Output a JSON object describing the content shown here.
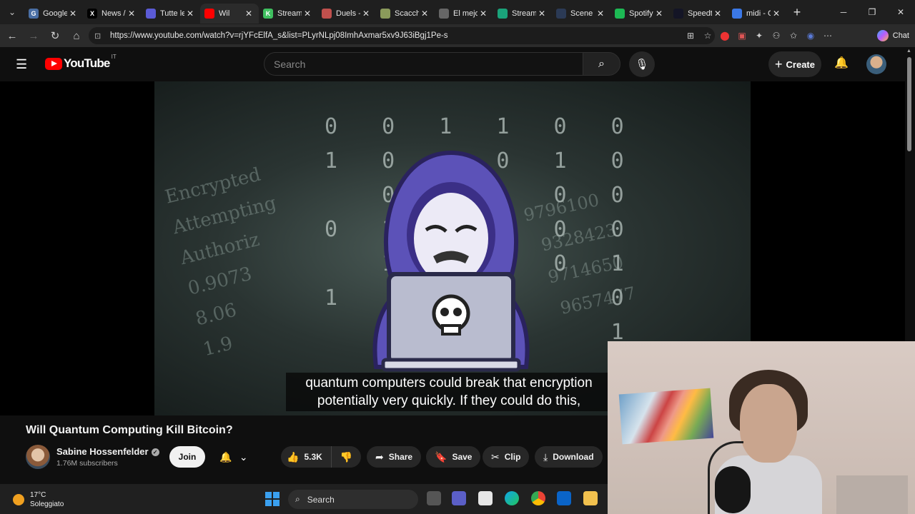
{
  "browser": {
    "tabs": [
      {
        "title": "Google",
        "color": "#4a6fa5",
        "glyph": "G",
        "active": false
      },
      {
        "title": "News /",
        "color": "#000000",
        "glyph": "X",
        "active": false
      },
      {
        "title": "Tutte le",
        "color": "#5b5bd6",
        "glyph": "",
        "active": false
      },
      {
        "title": "Wil",
        "color": "#ff0000",
        "glyph": "",
        "active": true
      },
      {
        "title": "Stream",
        "color": "#3fbf5f",
        "glyph": "K",
        "active": false
      },
      {
        "title": "Duels -",
        "color": "#c0504d",
        "glyph": "",
        "active": false
      },
      {
        "title": "Scacchi",
        "color": "#8a9a5b",
        "glyph": "",
        "active": false
      },
      {
        "title": "El mejo",
        "color": "#666666",
        "glyph": "",
        "active": false
      },
      {
        "title": "Streaml",
        "color": "#1aa37a",
        "glyph": "",
        "active": false
      },
      {
        "title": "Scene E",
        "color": "#2b3a55",
        "glyph": "",
        "active": false
      },
      {
        "title": "Spotify",
        "color": "#1db954",
        "glyph": "",
        "active": false
      },
      {
        "title": "Speedt",
        "color": "#141526",
        "glyph": "",
        "active": false
      },
      {
        "title": "midi - C",
        "color": "#3b78e7",
        "glyph": "",
        "active": false
      }
    ],
    "url": "https://www.youtube.com/watch?v=rjYFcElfA_s&list=PLyrNLpj08ImhAxmar5xv9J63iBgj1Pe-s",
    "chat_label": "Chat"
  },
  "youtube": {
    "logo_text": "YouTube",
    "country_code": "IT",
    "search_placeholder": "Search",
    "create_label": "Create"
  },
  "video": {
    "binary_rows": "0 0 1 1 0 0\n1 0 0 0 1 0\n  0   1 0 0\n0 1     0 0\n  1     0 1\n1         0\n          1",
    "code_background": "Encrypted\nAttempting\nAuthoriz\n0.9073\n8.06\n1.9",
    "number_background": "9796100\n  9328423\n  9714650\n   9657477",
    "caption_line1": "quantum computers could break that encryption",
    "caption_line2": "potentially very quickly. If they could do this,",
    "title": "Will Quantum Computing Kill Bitcoin?",
    "channel_name": "Sabine Hossenfelder",
    "subscribers": "1.76M subscribers",
    "join_label": "Join",
    "likes": "5.3K",
    "share_label": "Share",
    "save_label": "Save",
    "clip_label": "Clip",
    "download_label": "Download"
  },
  "taskbar": {
    "temperature": "17°C",
    "weather": "Soleggiato",
    "search_label": "Search"
  }
}
